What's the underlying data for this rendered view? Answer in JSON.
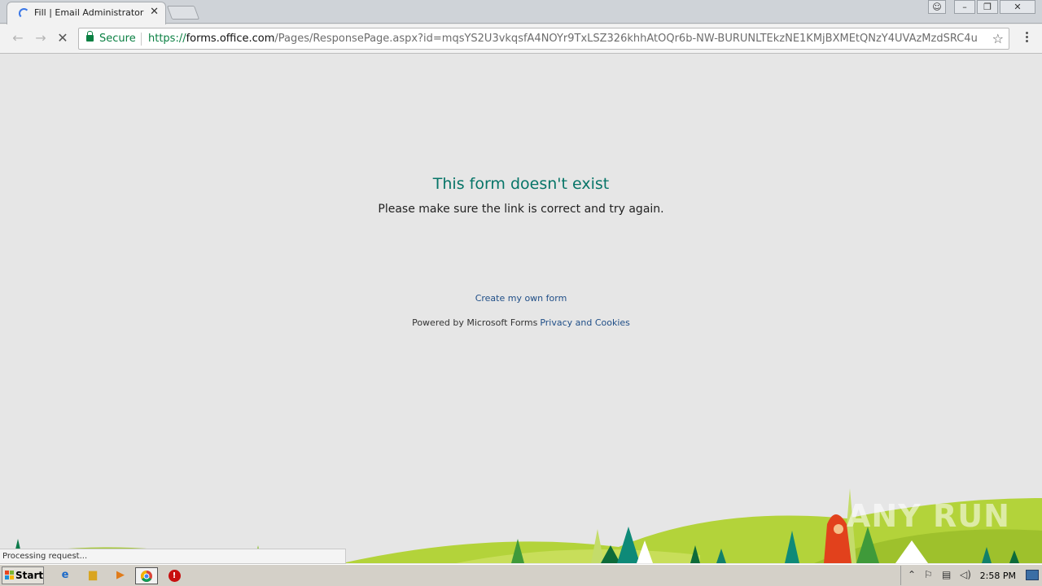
{
  "browser": {
    "tab_title": "Fill | Email Administrator",
    "tab_close": "✕",
    "secure_label": "Secure",
    "url_scheme": "https://",
    "url_host": "forms.office.com",
    "url_path": "/Pages/ResponsePage.aspx?id=mqsYS2U3vkqsfA4NOYr9TxLSZ326khhAtOQr6b-NW-BURUNLTEkzNE1KMjBXMEtQNzY4UVAzMzdSRC4u",
    "back_icon": "←",
    "forward_icon": "→",
    "stop_icon": "✕",
    "star_icon": "☆",
    "status_text": "Processing request..."
  },
  "page": {
    "error_title": "This form doesn't exist",
    "error_subtitle": "Please make sure the link is correct and try again.",
    "create_link": "Create my own form",
    "powered_by": "Powered by Microsoft Forms",
    "privacy_link": "Privacy and Cookies"
  },
  "watermark": "ANY RUN",
  "taskbar": {
    "start_label": "Start",
    "clock": "2:58 PM"
  }
}
